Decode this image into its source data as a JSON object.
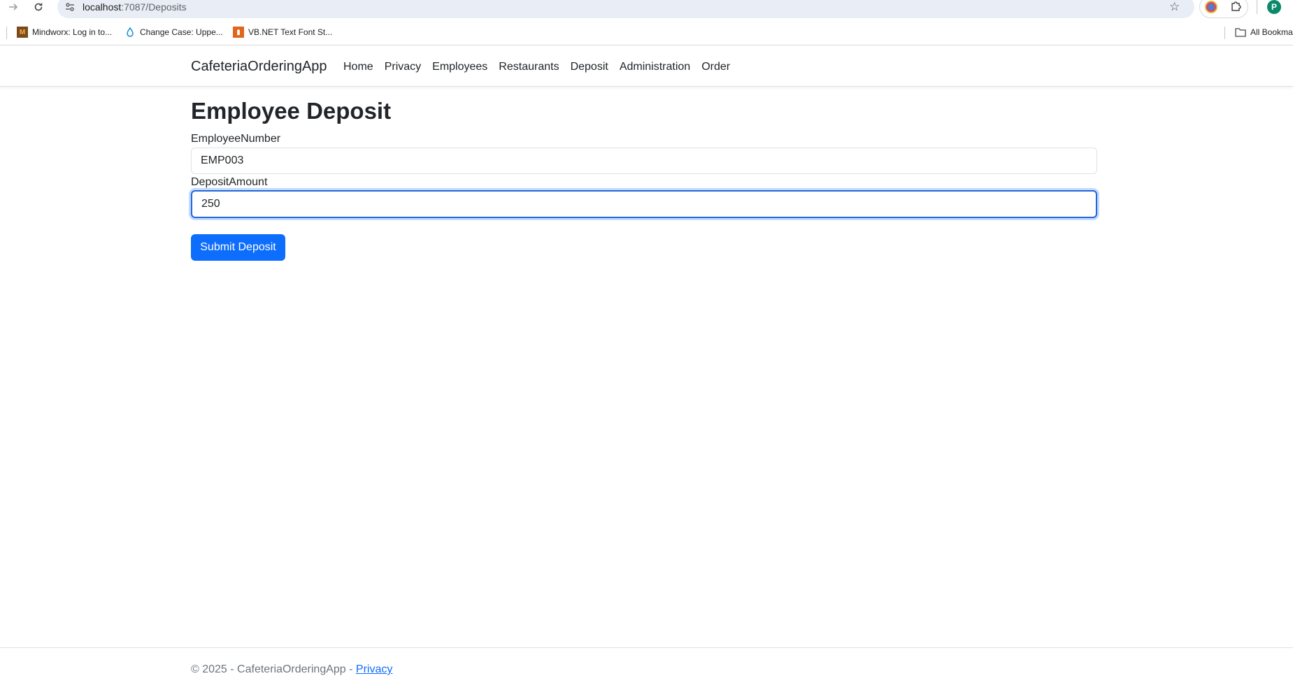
{
  "browser": {
    "url_host": "localhost",
    "url_path": ":7087/Deposits",
    "bookmarks": [
      {
        "label": "Mindworx: Log in to..."
      },
      {
        "label": "Change Case: Uppe..."
      },
      {
        "label": "VB.NET Text Font St..."
      }
    ],
    "all_bookmarks_label": "All Bookma",
    "profile_initial": "P"
  },
  "navbar": {
    "brand": "CafeteriaOrderingApp",
    "links": [
      "Home",
      "Privacy",
      "Employees",
      "Restaurants",
      "Deposit",
      "Administration",
      "Order"
    ]
  },
  "form": {
    "title": "Employee Deposit",
    "employee_number_label": "EmployeeNumber",
    "employee_number_value": "EMP003",
    "deposit_amount_label": "DepositAmount",
    "deposit_amount_value": "250",
    "submit_label": "Submit Deposit"
  },
  "footer": {
    "text": "© 2025 - CafeteriaOrderingApp - ",
    "privacy_link": "Privacy"
  },
  "colors": {
    "primary": "#0d6efd",
    "profile": "#0b8a6b"
  }
}
